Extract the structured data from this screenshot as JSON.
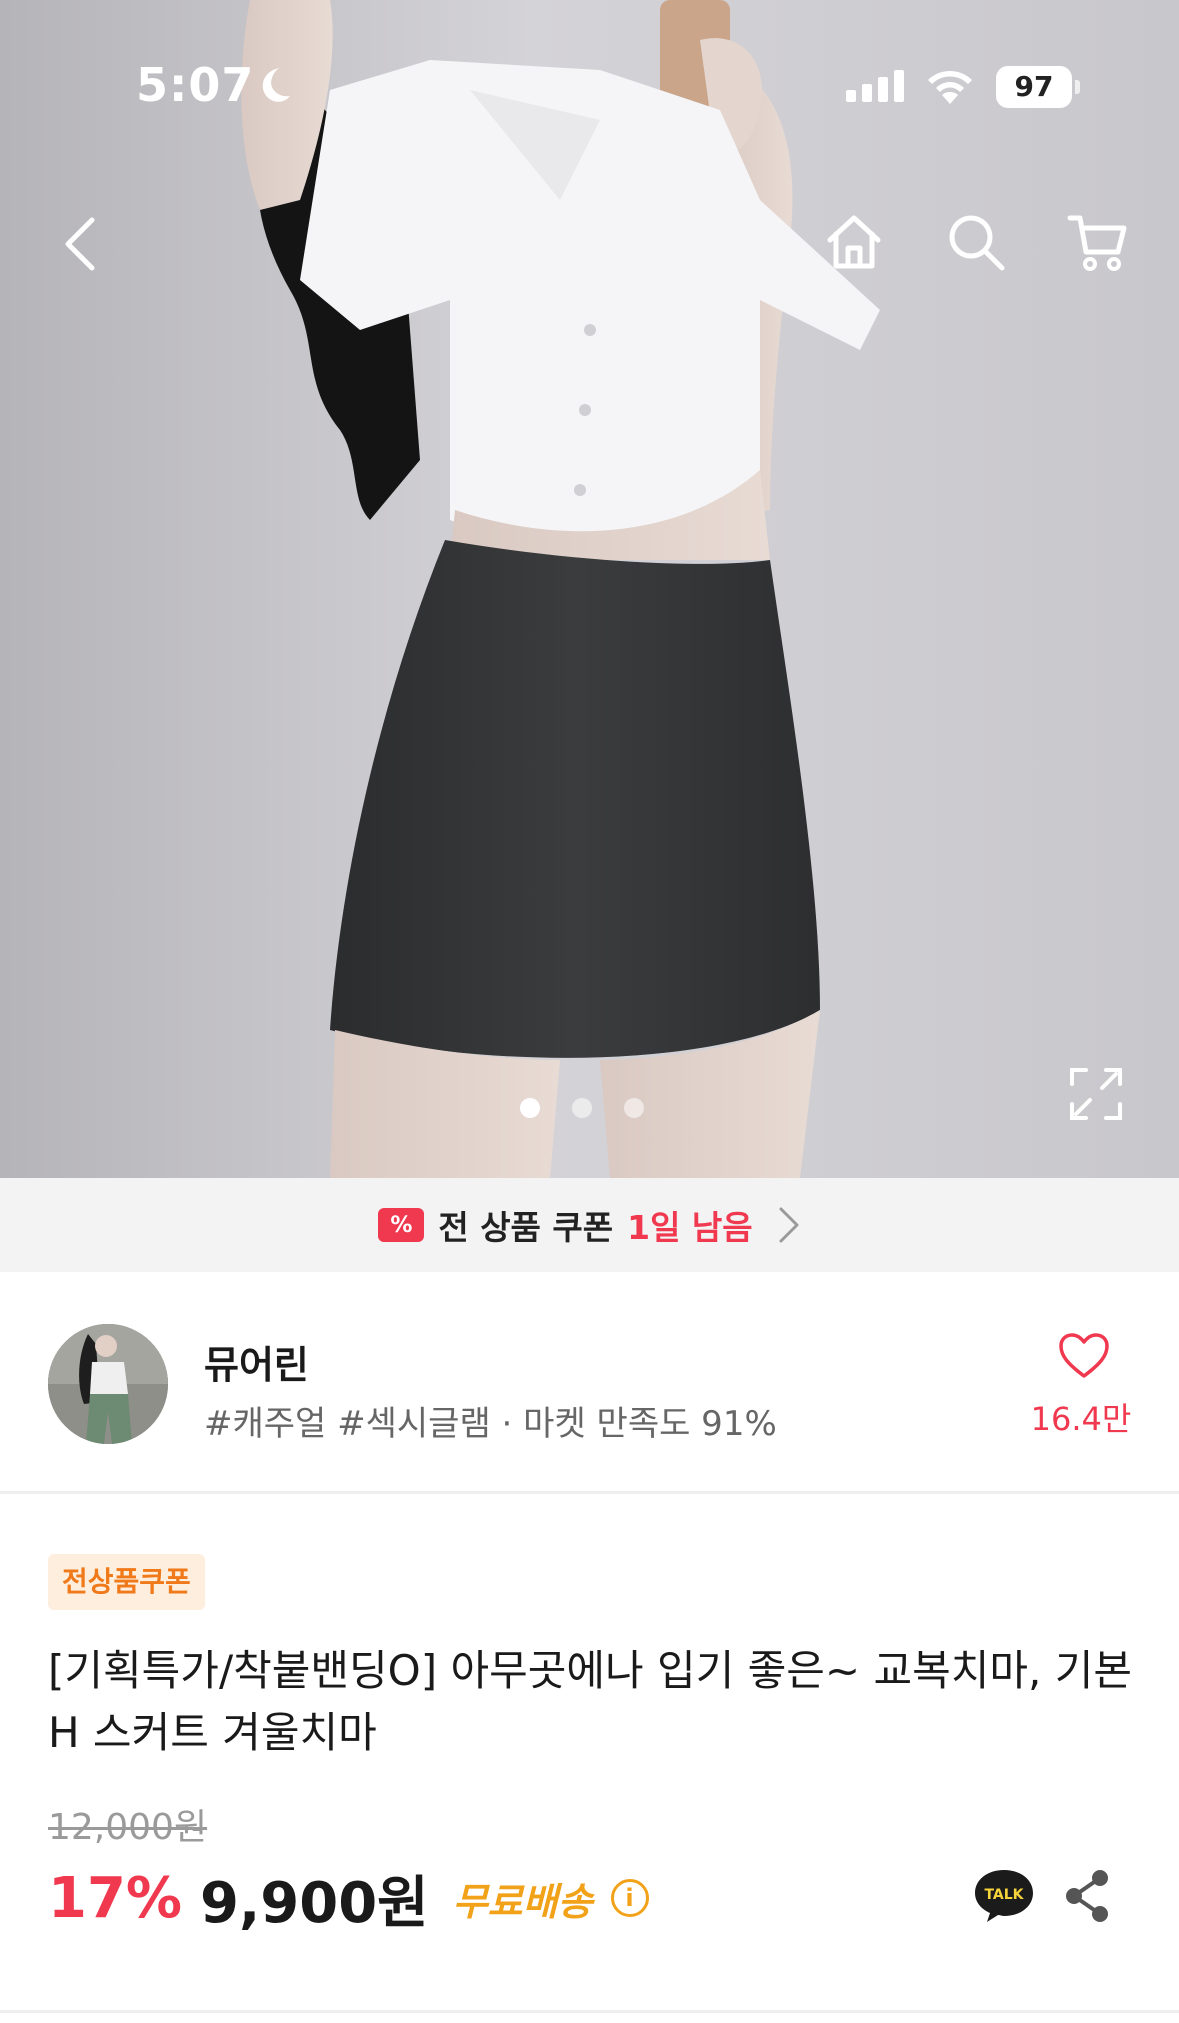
{
  "status_bar": {
    "time": "5:07",
    "battery": "97"
  },
  "top_nav": {
    "icons": [
      "back-icon",
      "home-icon",
      "search-icon",
      "cart-icon"
    ]
  },
  "gallery": {
    "slide_count": 3,
    "active_slide": 1
  },
  "coupon_banner": {
    "text": "전 상품 쿠폰",
    "days_left": "1일 남음",
    "accent_color": "#f0384f"
  },
  "shop": {
    "name": "뮤어린",
    "tags": "#캐주얼 #섹시글램 · 마켓 만족도 91%",
    "like_count": "16.4만"
  },
  "product": {
    "badge": "전상품쿠폰",
    "title": "[기획특가/착붙밴딩O] 아무곳에나 입기 좋은~ 교복치마, 기본 H 스커트 겨울치마",
    "original_price": "12,000원",
    "discount": "17%",
    "price": "9,900원",
    "shipping": "무료배송",
    "talk_label": "TALK"
  },
  "colors": {
    "accent": "#f0384f",
    "shipping": "#f2a218",
    "badge_bg": "#fdeedd",
    "badge_text": "#f07a1a"
  }
}
